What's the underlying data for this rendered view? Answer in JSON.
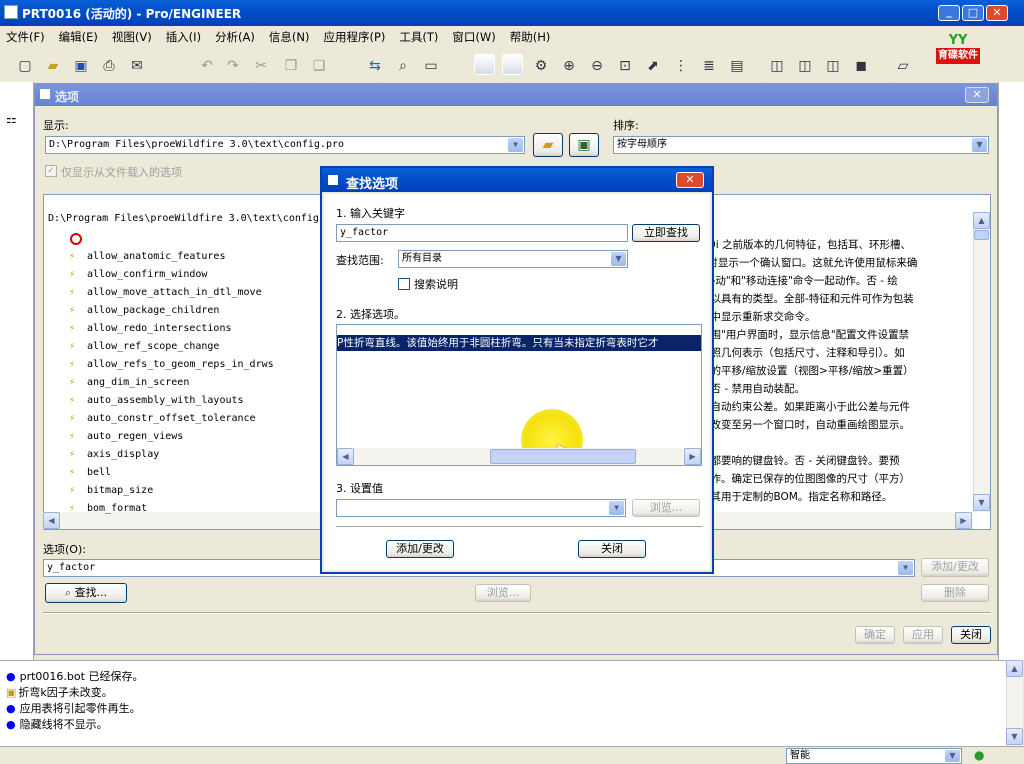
{
  "app": {
    "title": "PRT0016 (活动的) - Pro/ENGINEER",
    "menu": [
      "文件(F)",
      "编辑(E)",
      "视图(V)",
      "插入(I)",
      "分析(A)",
      "信息(N)",
      "应用程序(P)",
      "工具(T)",
      "窗口(W)",
      "帮助(H)"
    ],
    "logo_text": "育碟软件",
    "window_controls": {
      "minimize": "_",
      "restore": "□",
      "close": "✕"
    }
  },
  "options_dialog": {
    "title": "选项",
    "show_label": "显示:",
    "show_path": "D:\\Program Files\\proeWildfire 3.0\\text\\config.pro",
    "sort_label": "排序:",
    "sort_value": "按字母顺序",
    "only_loaded_checkbox": "仅显示从文件载入的选项",
    "list_header": "D:\\Program Files\\proeWildfire 3.0\\text\\config.",
    "options": [
      "allow_anatomic_features",
      "allow_confirm_window",
      "allow_move_attach_in_dtl_move",
      "allow_package_children",
      "allow_redo_intersections",
      "allow_ref_scope_change",
      "allow_refs_to_geom_reps_in_drws",
      "ang_dim_in_screen",
      "auto_assembly_with_layouts",
      "auto_constr_offset_tolerance",
      "auto_regen_views",
      "axis_display",
      "bell",
      "bitmap_size",
      "bom_format"
    ],
    "descriptions": [
      "E 2000i 之前版本的几何特征，包括耳、环形槽、",
      "NEER时显示一个确认窗口。这就允许使用鼠标来确",
      "中的\"移动\"和\"移动连接\"命令一起动作。否 - 绘",
      "元件可以具有的类型。全部-特征和元件可作为包装",
      "征菜单中显示重新求交命令。",
      "参照范围\"用户界面时，显示信息\"配置文件设置禁",
      "绘图参照几何表示（包括尺寸、注释和导引）。如",
      "在缺省的平移/缩放设置（视图>平移/缩放>重置）",
      "装配。否 - 禁用自动装配。",
      "尺寸的自动约束公差。如果距离小于此公差与元件",
      "个窗口改变至另一个窗口时，自动重画绘图显示。",
      "",
      "提示后都要响的键盘铃。否 - 关闭键盘铃。要预",
      "一起工作。确定已保存的位图图像的尺寸（平方）",
      "件，使其用于定制的BOM。指定名称和路径。"
    ],
    "option_label": "选项(O):",
    "option_value": "y_factor",
    "find_button": "查找...",
    "browse_button": "浏览...",
    "add_change_button": "添加/更改",
    "delete_button": "删除",
    "ok_button": "确定",
    "apply_button": "应用",
    "close_button": "关闭"
  },
  "find_dialog": {
    "title": "查找选项",
    "step1_label": "1.  输入关键字",
    "keyword_value": "y_factor",
    "search_now_button": "立即查找",
    "scope_label": "查找范围:",
    "scope_value": "所有目录",
    "search_desc_checkbox": "搜索说明",
    "step2_label": "2.  选择选项。",
    "result_text": "P性折弯直线。该值始终用于非圆柱折弯。只有当未指定折弯表时它才",
    "step3_label": "3.  设置值",
    "browse_button": "浏览...",
    "add_change_button": "添加/更改",
    "close_button": "关闭"
  },
  "messages": [
    "prt0016.bot 已经保存。",
    "折弯k因子未改变。",
    "应用表将引起零件再生。",
    "隐藏线将不显示。"
  ],
  "status_bar": {
    "filter_value": "智能"
  },
  "colors": {
    "xp_blue": "#0050c8",
    "cursor_highlight": "#ffee00",
    "selection": "#0a246a"
  }
}
